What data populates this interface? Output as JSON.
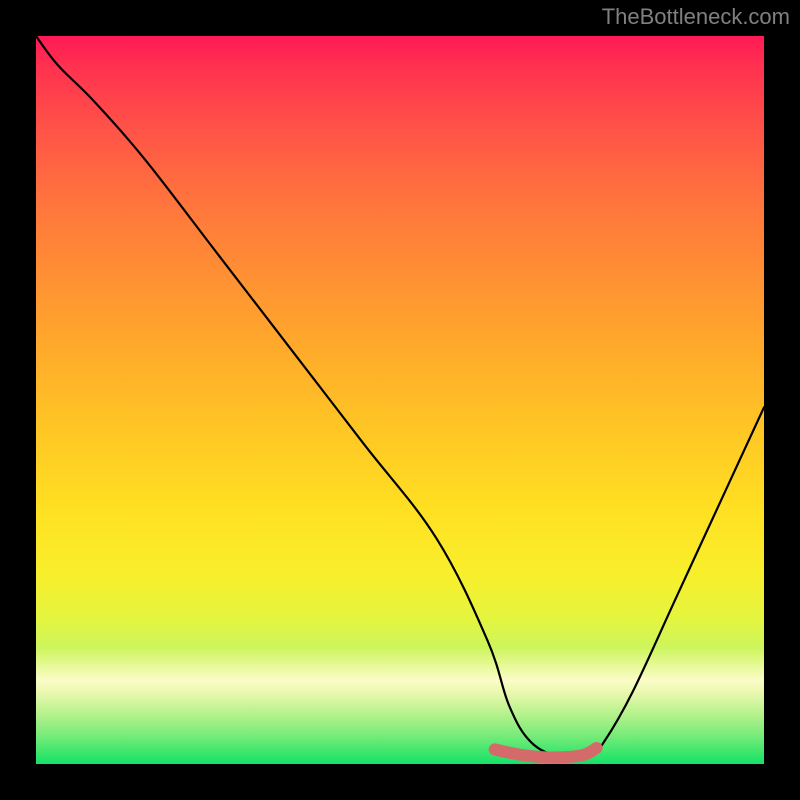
{
  "watermark": "TheBottleneck.com",
  "chart_data": {
    "type": "line",
    "title": "",
    "xlabel": "",
    "ylabel": "",
    "xlim": [
      0,
      100
    ],
    "ylim": [
      0,
      100
    ],
    "series": [
      {
        "name": "bottleneck-curve",
        "x": [
          0,
          3,
          8,
          15,
          25,
          35,
          45,
          55,
          62,
          65,
          68,
          72,
          76,
          78,
          82,
          88,
          94,
          100
        ],
        "y": [
          100,
          96,
          91,
          83,
          70,
          57,
          44,
          31,
          17,
          8,
          3,
          1,
          1,
          3,
          10,
          23,
          36,
          49
        ]
      },
      {
        "name": "highlight-flat",
        "x": [
          63,
          67,
          71,
          75,
          77
        ],
        "y": [
          2.0,
          1.2,
          0.9,
          1.2,
          2.2
        ]
      }
    ],
    "gradient_scale": [
      {
        "pos": 0,
        "color": "#ff1a55"
      },
      {
        "pos": 50,
        "color": "#ffc020"
      },
      {
        "pos": 90,
        "color": "#e8f77a"
      },
      {
        "pos": 100,
        "color": "#14e069"
      }
    ]
  }
}
